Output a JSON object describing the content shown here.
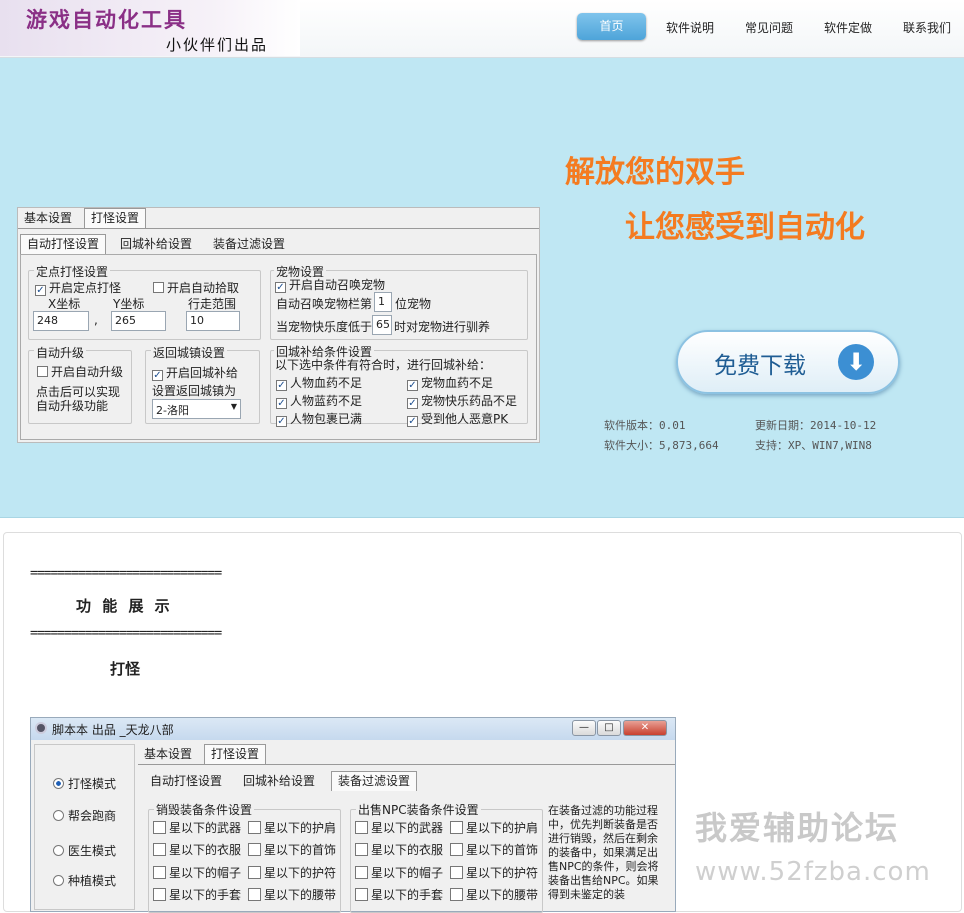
{
  "header": {
    "logo_title": "游戏自动化工具",
    "logo_sub": "小伙伴们出品",
    "nav": [
      "首页",
      "软件说明",
      "常见问题",
      "软件定做",
      "联系我们"
    ]
  },
  "hero": {
    "slogan1": "解放您的双手",
    "slogan2": "让您感受到自动化",
    "download_label": "免费下载",
    "download_icon": "arrow-down-icon",
    "version_label": "软件版本：0.01",
    "date_label": "更新日期：2014-10-12",
    "size_label": "软件大小：5,873,664",
    "support_label": "支持：XP、WIN7,WIN8"
  },
  "dialog1": {
    "outer_tabs": [
      "基本设置",
      "打怪设置"
    ],
    "inner_tabs": [
      "自动打怪设置",
      "回城补给设置",
      "装备过滤设置"
    ],
    "fixed": {
      "title": "定点打怪设置",
      "cb_fixed": "开启定点打怪",
      "cb_pickup": "开启自动拾取",
      "x_label": "X坐标",
      "y_label": "Y坐标",
      "range_label": "行走范围",
      "x": "248",
      "y": "265",
      "range": "10",
      "comma": ","
    },
    "pet": {
      "title": "宠物设置",
      "cb_summon": "开启自动召唤宠物",
      "slot_prefix": "自动召唤宠物栏第",
      "slot": "1",
      "slot_suffix": "位宠物",
      "happy_prefix": "当宠物快乐度低于",
      "happy": "65",
      "happy_suffix": "时对宠物进行驯养"
    },
    "upgrade": {
      "title": "自动升级",
      "cb": "开启自动升级",
      "desc1": "点击后可以实现",
      "desc2": "自动升级功能"
    },
    "town": {
      "title": "返回城镇设置",
      "cb": "开启回城补给",
      "set_label": "设置返回城镇为",
      "city": "2-洛阳"
    },
    "supply": {
      "title": "回城补给条件设置",
      "desc": "以下选中条件有符合时，进行回城补给：",
      "c1": "人物血药不足",
      "c2": "宠物血药不足",
      "c3": "人物蓝药不足",
      "c4": "宠物快乐药品不足",
      "c5": "人物包裹已满",
      "c6": "受到他人恶意PK"
    }
  },
  "content": {
    "divider": "============================",
    "heading": "功 能 展 示",
    "sub": "打怪"
  },
  "dialog2": {
    "title": "脚本本 出品 _天龙八部",
    "modes": [
      "打怪模式",
      "帮会跑商",
      "医生模式",
      "种植模式"
    ],
    "outer_tabs": [
      "基本设置",
      "打怪设置"
    ],
    "inner_tabs": [
      "自动打怪设置",
      "回城补给设置",
      "装备过滤设置"
    ],
    "destroy_title": "销毁装备条件设置",
    "sell_title": "出售NPC装备条件设置",
    "items_left": [
      "星以下的武器",
      "星以下的衣服",
      "星以下的帽子",
      "星以下的手套"
    ],
    "items_right": [
      "星以下的护肩",
      "星以下的首饰",
      "星以下的护符",
      "星以下的腰带"
    ],
    "note": "在装备过滤的功能过程中，优先判断装备是否进行销毁，然后在剩余的装备中，如果满足出售NPC的条件，则会将装备出售给NPC。如果得到未鉴定的装"
  },
  "watermark": {
    "line1": "我爱辅助论坛",
    "line2": "www.52fzba.com"
  }
}
